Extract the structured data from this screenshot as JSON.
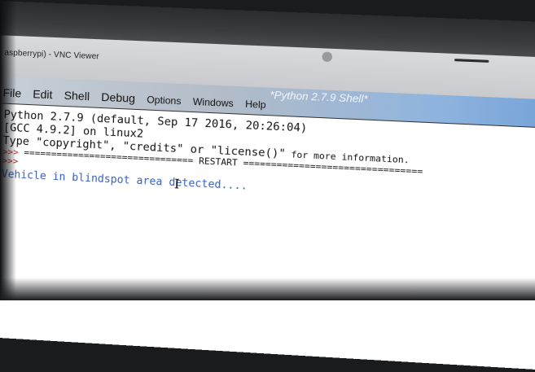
{
  "vnc": {
    "title": "aspberrypi) - VNC Viewer"
  },
  "window": {
    "title": "*Python 2.7.9 Shell*",
    "controls": "– ▫ ×"
  },
  "menu": {
    "items": [
      "File",
      "Edit",
      "Shell",
      "Debug",
      "Options",
      "Windows",
      "Help"
    ]
  },
  "shell": {
    "line1": "Python 2.7.9 (default, Sep 17 2016, 20:26:04)",
    "line2": "[GCC 4.9.2] on linux2",
    "line3a": "Type \"copyright\", \"credits\" or \"license()\"",
    "line3b": " for more information.",
    "prompt": ">>>",
    "restart": " =============================== RESTART ================================",
    "output": "Vehicle in blindspot area detected...."
  },
  "colors": {
    "prompt": "#c2262e",
    "output": "#3560c7",
    "title_bar_accent": "#6d9ed6"
  }
}
